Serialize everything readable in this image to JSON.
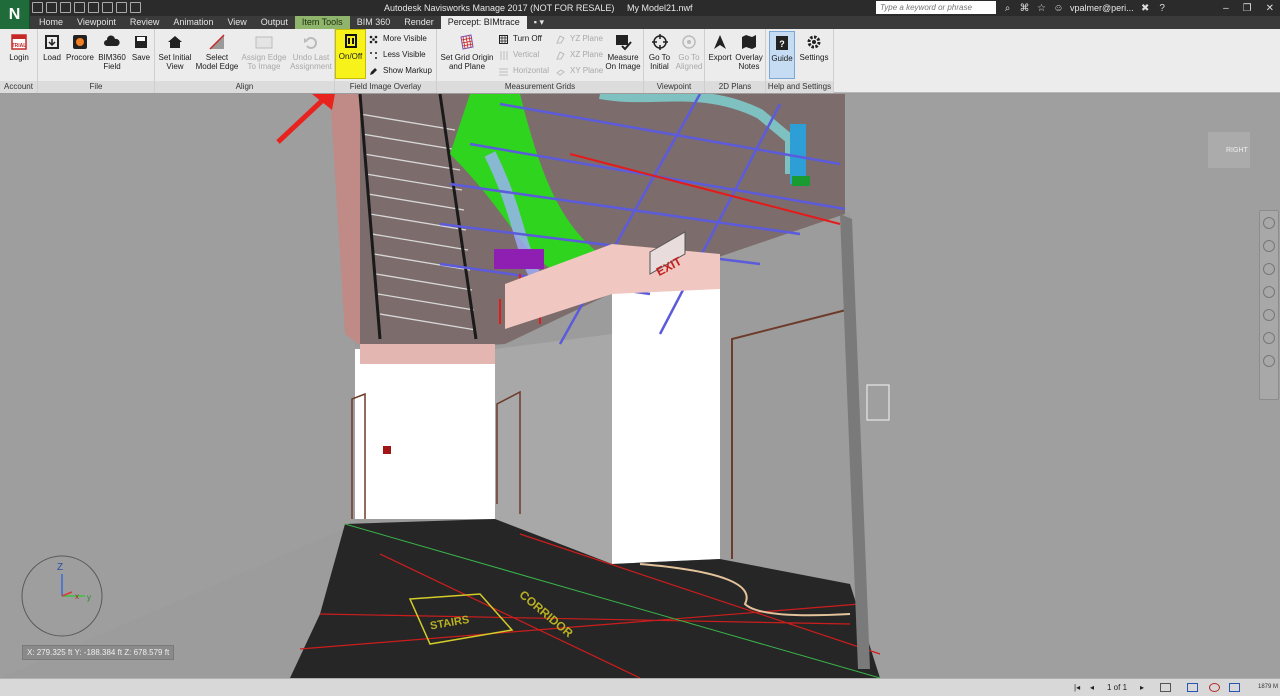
{
  "titlebar": {
    "app_logo": "N",
    "title": "Autodesk Navisworks Manage 2017 (NOT FOR RESALE)",
    "file": "My Model21.nwf",
    "search_placeholder": "Type a keyword or phrase",
    "user": "vpalmer@peri..."
  },
  "tabs": [
    {
      "label": "Home"
    },
    {
      "label": "Viewpoint"
    },
    {
      "label": "Review"
    },
    {
      "label": "Animation"
    },
    {
      "label": "View"
    },
    {
      "label": "Output"
    },
    {
      "label": "Item Tools"
    },
    {
      "label": "BIM 360"
    },
    {
      "label": "Render"
    },
    {
      "label": "Percept: BIMtrace"
    }
  ],
  "ribbon": {
    "panels": {
      "account": "Account",
      "file": "File",
      "align": "Align",
      "field_image_overlay": "Field Image Overlay",
      "measurement_grids": "Measurement Grids",
      "viewpoint": "Viewpoint",
      "plans_2d": "2D Plans",
      "help": "Help and Settings"
    },
    "trial_badge": "TRIAL",
    "buttons": {
      "login": "Login",
      "load": "Load",
      "procore": "Procore",
      "bim360_field": "BIM360 Field",
      "save": "Save",
      "set_initial_view": "Set Initial View",
      "select_model_edge": "Select Model Edge",
      "assign_edge": "Assign Edge To Image",
      "undo_last": "Undo Last Assignment",
      "on_off": "On/Off",
      "more_visible": "More Visible",
      "less_visible": "Less Visible",
      "show_markup": "Show Markup",
      "set_grid_origin": "Set Grid Origin and Plane",
      "turn_off": "Turn Off",
      "vertical": "Vertical",
      "horizontal": "Horizontal",
      "yz_plane": "YZ Plane",
      "xz_plane": "XZ Plane",
      "xy_plane": "XY Plane",
      "measure_on_image": "Measure On Image",
      "go_to_initial": "Go To Initial",
      "go_to_aligned": "Go To Aligned",
      "export": "Export",
      "overlay_notes": "Overlay Notes",
      "guide": "Guide",
      "settings": "Settings"
    }
  },
  "viewport": {
    "exit_sign": "EXIT",
    "floor_text_1": "STAIRS",
    "floor_text_2": "CORRIDOR",
    "view_cube_face": "RIGHT",
    "axis_z": "Z",
    "axis_x": "x",
    "axis_y": "y",
    "coordinates": "X: 279.325 ft  Y: -188.384 ft  Z: 678.579 ft"
  },
  "statusbar": {
    "page": "1 of 1",
    "memory": "1879 M"
  },
  "colors": {
    "highlight": "#f8f21b",
    "arrow": "#e8231e",
    "context_tab": "#8fb56c"
  }
}
